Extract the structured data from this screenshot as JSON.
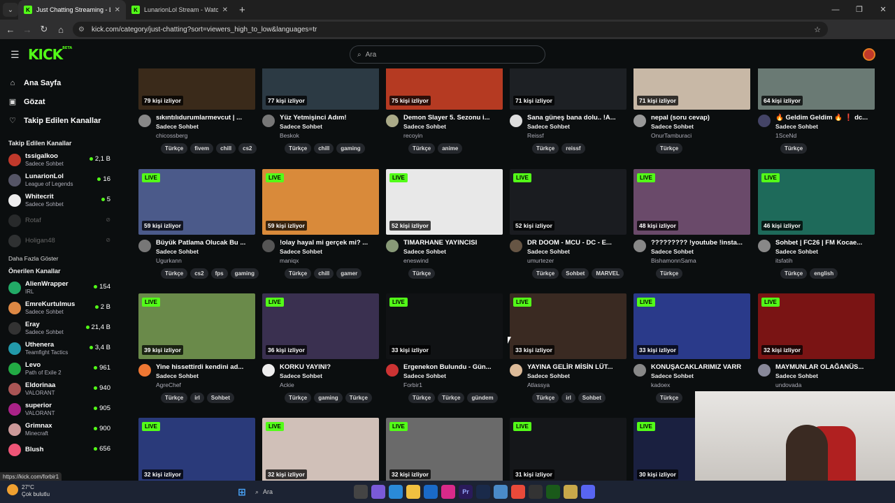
{
  "browser": {
    "tabs": [
      {
        "title": "Just Chatting Streaming - Live S",
        "active": true
      },
      {
        "title": "LunarionLol Stream - Watch Liv",
        "active": false
      }
    ],
    "new_tab": "+",
    "url": "kick.com/category/just-chatting?sort=viewers_high_to_low&languages=tr",
    "profile_letter": "B",
    "status_url": "https://kick.com/forbir1"
  },
  "header": {
    "logo": "KICK",
    "beta": "BETA",
    "search_placeholder": "Ara"
  },
  "sidebar": {
    "nav": [
      {
        "icon": "home-icon",
        "glyph": "⌂",
        "label": "Ana Sayfa"
      },
      {
        "icon": "browse-icon",
        "glyph": "▣",
        "label": "Gözat"
      },
      {
        "icon": "heart-icon",
        "glyph": "♡",
        "label": "Takip Edilen Kanallar"
      }
    ],
    "followed_title": "Takip Edilen Kanallar",
    "followed": [
      {
        "name": "tssigalkoo",
        "category": "Sadece Sohbet",
        "count": "2,1 B",
        "color": "#c0392b"
      },
      {
        "name": "LunarionLol",
        "category": "League of Legends",
        "count": "16",
        "color": "#556"
      },
      {
        "name": "Whitecrit",
        "category": "Sadece Sohbet",
        "count": "5",
        "color": "#eee"
      },
      {
        "name": "Rotaf",
        "category": "",
        "count": "",
        "color": "#555",
        "offline": true
      },
      {
        "name": "Holigan48",
        "category": "",
        "count": "",
        "color": "#666",
        "offline": true
      }
    ],
    "show_more": "Daha Fazla Göster",
    "recommended_title": "Önerilen Kanallar",
    "recommended": [
      {
        "name": "AlienWrapper",
        "category": "IRL",
        "count": "154",
        "color": "#2a6"
      },
      {
        "name": "EmreKurtulmus",
        "category": "Sadece Sohbet",
        "count": "2 B",
        "color": "#d84"
      },
      {
        "name": "Eray",
        "category": "Sadece Sohbet",
        "count": "21,4 B",
        "color": "#333"
      },
      {
        "name": "Uthenera",
        "category": "Teamfight Tactics",
        "count": "3,4 B",
        "color": "#29a"
      },
      {
        "name": "Levo",
        "category": "Path of Exile 2",
        "count": "961",
        "color": "#2a4"
      },
      {
        "name": "Eldorinaa",
        "category": "VALORANT",
        "count": "940",
        "color": "#a55"
      },
      {
        "name": "superior",
        "category": "VALORANT",
        "count": "905",
        "color": "#a28"
      },
      {
        "name": "Grimnax",
        "category": "Minecraft",
        "count": "900",
        "color": "#c99"
      },
      {
        "name": "Blush",
        "category": "",
        "count": "656",
        "color": "#e57"
      }
    ]
  },
  "streams": [
    {
      "title": "sıkıntılıdurumlarmevcut | ...",
      "category": "Sadece Sohbet",
      "channel": "chicossberg",
      "viewers": "79 kişi izliyor",
      "live": false,
      "tags": [
        "Türkçe",
        "fivem",
        "chill",
        "cs2"
      ],
      "thumb": "#3a2a1a",
      "avatar": "#888"
    },
    {
      "title": "Yüz Yetmişinci Adım!",
      "category": "Sadece Sohbet",
      "channel": "Beskok",
      "viewers": "77 kişi izliyor",
      "live": false,
      "tags": [
        "Türkçe",
        "chill",
        "gaming"
      ],
      "thumb": "#2c3a44",
      "avatar": "#777"
    },
    {
      "title": "Demon Slayer 5. Sezonu i...",
      "category": "Sadece Sohbet",
      "channel": "recoyin",
      "viewers": "75 kişi izliyor",
      "live": false,
      "tags": [
        "Türkçe",
        "anime"
      ],
      "thumb": "#b53a22",
      "avatar": "#aa8"
    },
    {
      "title": "Sana güneş bana dolu.. !A...",
      "category": "Sadece Sohbet",
      "channel": "Reissf",
      "viewers": "71 kişi izliyor",
      "live": false,
      "tags": [
        "Türkçe",
        "reissf"
      ],
      "thumb": "#1d2024",
      "avatar": "#ddd"
    },
    {
      "title": "nepal (soru cevap)",
      "category": "Sadece Sohbet",
      "channel": "OnurTamburaci",
      "viewers": "71 kişi izliyor",
      "live": false,
      "tags": [
        "Türkçe"
      ],
      "thumb": "#c8b8a6",
      "avatar": "#999"
    },
    {
      "title": "🔥 Geldim Geldim 🔥 ❗ dc...",
      "category": "Sadece Sohbet",
      "channel": "1SceNd",
      "viewers": "64 kişi izliyor",
      "live": false,
      "tags": [
        "Türkçe"
      ],
      "thumb": "#6a7a74",
      "avatar": "#446"
    },
    {
      "title": "Büyük Patlama Olucak Bu ...",
      "category": "Sadece Sohbet",
      "channel": "Ugurkann",
      "viewers": "59 kişi izliyor",
      "live": true,
      "tags": [
        "Türkçe",
        "cs2",
        "fps",
        "gaming"
      ],
      "thumb": "#4b5a8a",
      "avatar": "#777"
    },
    {
      "title": "!olay hayal mi gerçek mi? ...",
      "category": "Sadece Sohbet",
      "channel": "maniqx",
      "viewers": "59 kişi izliyor",
      "live": true,
      "tags": [
        "Türkçe",
        "chill",
        "gamer"
      ],
      "thumb": "#d98a3a",
      "avatar": "#555"
    },
    {
      "title": "TIMARHANE YAYINCISI",
      "category": "Sadece Sohbet",
      "channel": "eneswind",
      "viewers": "52 kişi izliyor",
      "live": true,
      "tags": [
        "Türkçe"
      ],
      "thumb": "#e8e8e8",
      "avatar": "#897"
    },
    {
      "title": "DR DOOM - MCU - DC - E...",
      "category": "Sadece Sohbet",
      "channel": "umurtezer",
      "viewers": "52 kişi izliyor",
      "live": true,
      "tags": [
        "Türkçe",
        "Sohbet",
        "MARVEL"
      ],
      "thumb": "#1a1c20",
      "avatar": "#654"
    },
    {
      "title": "????????? !youtube !insta...",
      "category": "Sadece Sohbet",
      "channel": "BishamonnSama",
      "viewers": "48 kişi izliyor",
      "live": true,
      "tags": [
        "Türkçe"
      ],
      "thumb": "#6a4a6a",
      "avatar": "#888"
    },
    {
      "title": "Sohbet | FC26 | FM Kocae...",
      "category": "Sadece Sohbet",
      "channel": "itsfatih",
      "viewers": "46 kişi izliyor",
      "live": true,
      "tags": [
        "Türkçe",
        "english"
      ],
      "thumb": "#1e6a5a",
      "avatar": "#888"
    },
    {
      "title": "Yine hissettirdi kendini ad...",
      "category": "Sadece Sohbet",
      "channel": "AgreChef",
      "viewers": "39 kişi izliyor",
      "live": true,
      "tags": [
        "Türkçe",
        "irl",
        "Sohbet"
      ],
      "thumb": "#6a8a4a",
      "avatar": "#e73"
    },
    {
      "title": "KORKU YAYINI?",
      "category": "Sadece Sohbet",
      "channel": "Ackie",
      "viewers": "36 kişi izliyor",
      "live": true,
      "tags": [
        "Türkçe",
        "gaming",
        "Türkçe"
      ],
      "thumb": "#3a3050",
      "avatar": "#eee"
    },
    {
      "title": "Ergenekon Bulundu - Gün...",
      "category": "Sadece Sohbet",
      "channel": "Forbir1",
      "viewers": "33 kişi izliyor",
      "live": true,
      "tags": [
        "Türkçe",
        "Türkçe",
        "gündem"
      ],
      "thumb": "#101214",
      "avatar": "#c33"
    },
    {
      "title": "YAYINA GELİR MİSİN LÜT...",
      "category": "Sadece Sohbet",
      "channel": "Atlassya",
      "viewers": "33 kişi izliyor",
      "live": true,
      "tags": [
        "Türkçe",
        "irl",
        "Sohbet"
      ],
      "thumb": "#3a2a22",
      "avatar": "#db9"
    },
    {
      "title": "KONUŞACAKLARIMIZ VARR",
      "category": "Sadece Sohbet",
      "channel": "kadoex",
      "viewers": "33 kişi izliyor",
      "live": true,
      "tags": [
        "Türkçe"
      ],
      "thumb": "#2a3a8a",
      "avatar": "#888"
    },
    {
      "title": "MAYMUNLAR OLAĞANÜS...",
      "category": "Sadece Sohbet",
      "channel": "undovada",
      "viewers": "32 kişi izliyor",
      "live": true,
      "tags": [],
      "thumb": "#7a1414",
      "avatar": "#889"
    },
    {
      "title": "",
      "category": "",
      "channel": "",
      "viewers": "32 kişi izliyor",
      "live": true,
      "tags": [],
      "thumb": "#2a3a7a",
      "avatar": "#333"
    },
    {
      "title": "",
      "category": "",
      "channel": "",
      "viewers": "32 kişi izliyor",
      "live": true,
      "tags": [],
      "thumb": "#d0c0b8",
      "avatar": "#333"
    },
    {
      "title": "",
      "category": "",
      "channel": "",
      "viewers": "32 kişi izliyor",
      "live": true,
      "tags": [],
      "thumb": "#6a6a6a",
      "avatar": "#333"
    },
    {
      "title": "",
      "category": "",
      "channel": "",
      "viewers": "31 kişi izliyor",
      "live": true,
      "tags": [],
      "thumb": "#15171a",
      "avatar": "#333"
    },
    {
      "title": "",
      "category": "",
      "channel": "",
      "viewers": "30 kişi izliyor",
      "live": true,
      "tags": [],
      "thumb": "#1a2040",
      "avatar": "#333"
    }
  ],
  "taskbar": {
    "temp": "27°C",
    "weather": "Çok bulutlu",
    "search": "Ara",
    "badge": "9"
  }
}
